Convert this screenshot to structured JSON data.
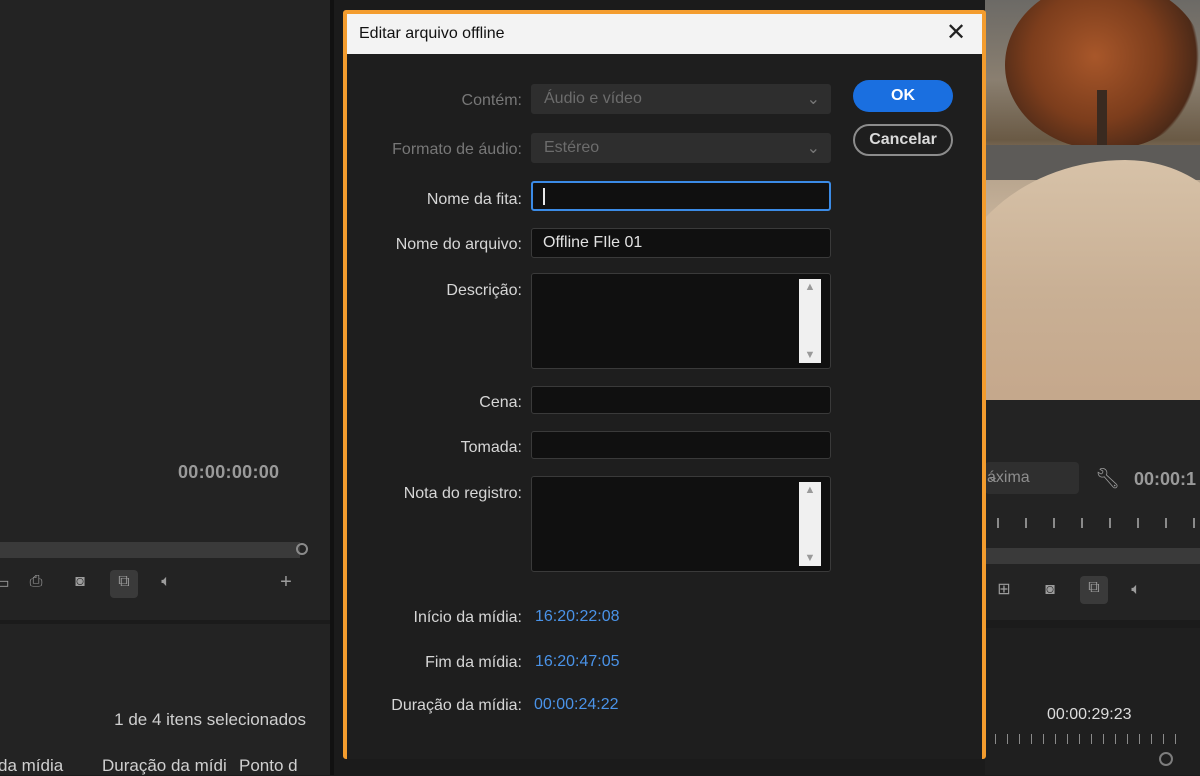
{
  "background": {
    "left_panel": {
      "timecode": "00:00:00:00",
      "controls": [
        "export-frame-icon",
        "camera-icon",
        "overlay-toggle-icon",
        "speaker-icon",
        "add-icon"
      ]
    },
    "project_panel": {
      "selection_text": "1 de 4 itens selecionados",
      "columns": [
        "da mídia",
        "Duração da mídi",
        "Ponto d"
      ]
    },
    "program_monitor": {
      "quality_label": "áxima",
      "timecode": "00:00:1"
    },
    "timeline": {
      "timecode": "00:00:29:23"
    }
  },
  "dialog": {
    "title": "Editar arquivo offline",
    "ok_label": "OK",
    "cancel_label": "Cancelar",
    "fields": {
      "contains": {
        "label": "Contém:",
        "value": "Áudio e vídeo"
      },
      "audio_format": {
        "label": "Formato de áudio:",
        "value": "Estéreo"
      },
      "tape_name": {
        "label": "Nome da fita:",
        "value": ""
      },
      "file_name": {
        "label": "Nome do arquivo:",
        "value": "Offline FIle 01"
      },
      "description": {
        "label": "Descrição:",
        "value": ""
      },
      "scene": {
        "label": "Cena:",
        "value": ""
      },
      "take": {
        "label": "Tomada:",
        "value": ""
      },
      "log_note": {
        "label": "Nota do registro:",
        "value": ""
      },
      "media_start": {
        "label": "Início da mídia:",
        "value": "16:20:22:08"
      },
      "media_end": {
        "label": "Fim da mídia:",
        "value": "16:20:47:05"
      },
      "media_duration": {
        "label": "Duração da mídia:",
        "value": "00:00:24:22"
      }
    }
  },
  "colors": {
    "dialog_border": "#f39c2e",
    "ok_button": "#1a6fe0",
    "timecode_value": "#4a93e8",
    "focus_ring": "#3b8be6"
  }
}
